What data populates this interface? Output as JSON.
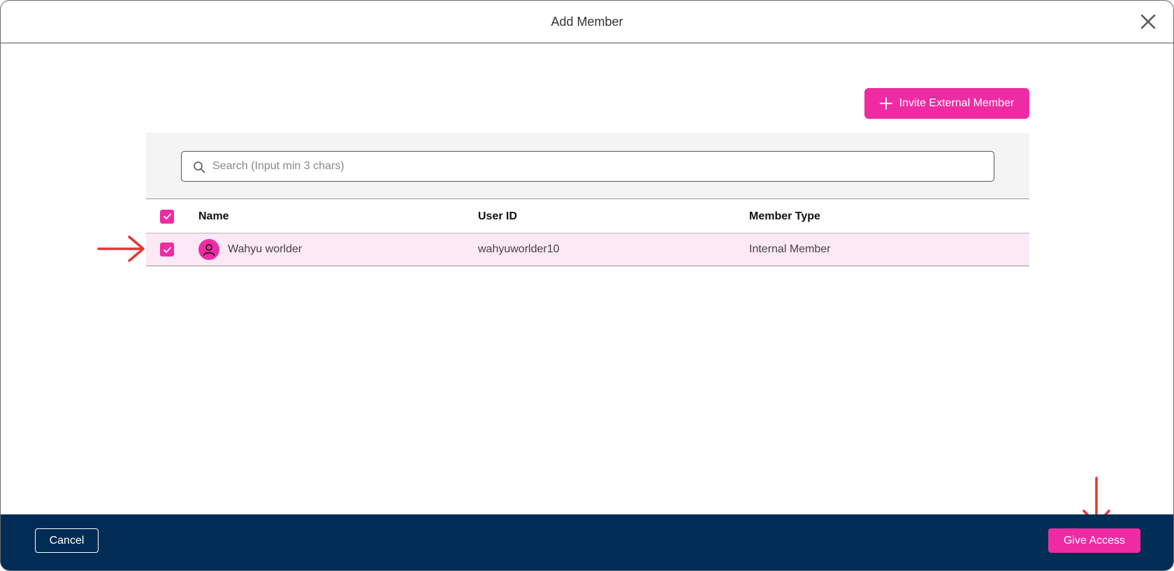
{
  "header": {
    "title": "Add Member"
  },
  "toolbar": {
    "invite_label": "Invite External Member"
  },
  "search": {
    "placeholder": "Search (Input min 3 chars)",
    "value": ""
  },
  "table": {
    "columns": [
      "Name",
      "User ID",
      "Member Type"
    ],
    "rows": [
      {
        "name": "Wahyu worlder",
        "user_id": "wahyuworlder10",
        "member_type": "Internal Member",
        "selected": true
      }
    ]
  },
  "footer": {
    "cancel_label": "Cancel",
    "give_access_label": "Give Access"
  },
  "colors": {
    "accent": "#ef2ba3",
    "footer_bg": "#002c55",
    "selected_row": "#fde8f5",
    "annotation_arrow": "#e23636"
  }
}
